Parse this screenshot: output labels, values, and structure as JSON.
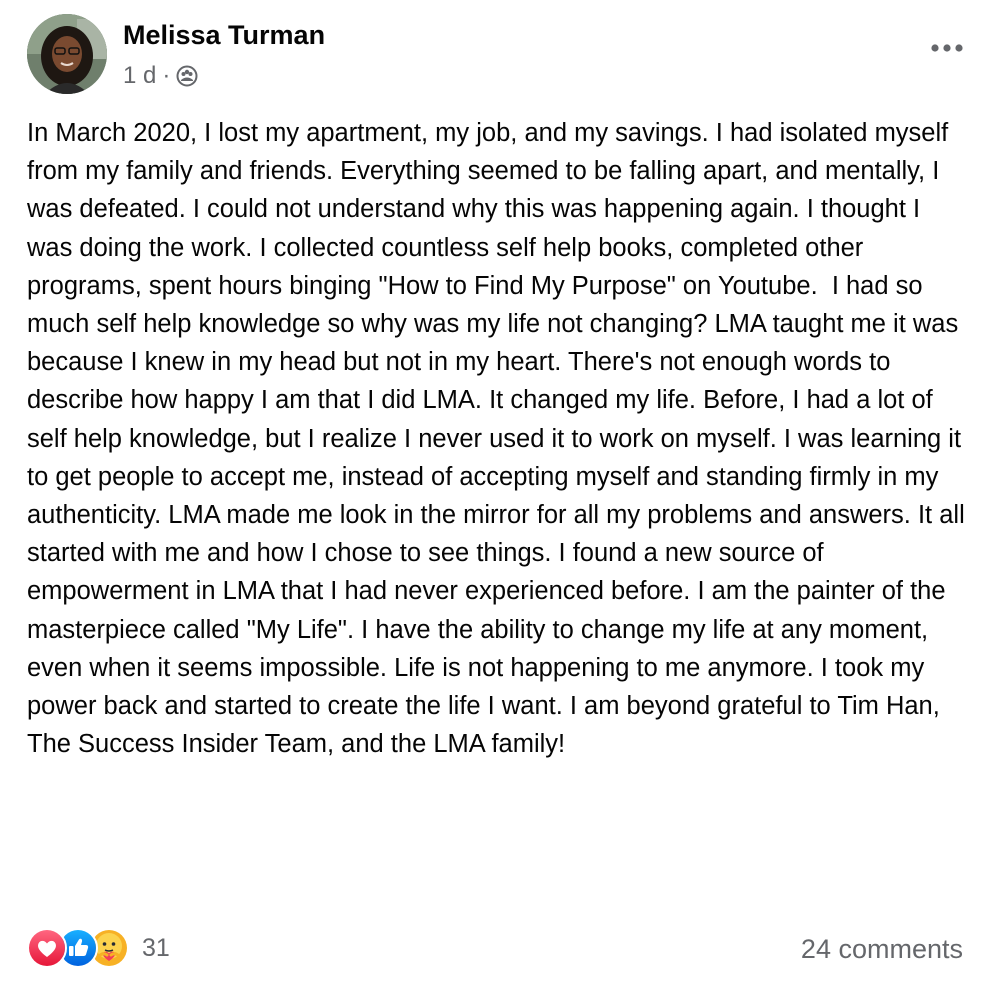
{
  "post": {
    "author": "Melissa Turman",
    "time": "1 d",
    "separator": "·",
    "audience_icon": "friends-group-icon",
    "body": "In March 2020, I lost my apartment, my job, and my savings. I had isolated myself from my family and friends. Everything seemed to be falling apart, and mentally, I was defeated. I could not understand why this was happening again. I thought I was doing the work. I collected countless self help books, completed other programs, spent hours binging \"How to Find My Purpose\" on Youtube.  I had so much self help knowledge so why was my life not changing? LMA taught me it was because I knew in my head but not in my heart. There's not enough words to describe how happy I am that I did LMA. It changed my life. Before, I had a lot of self help knowledge, but I realize I never used it to work on myself. I was learning it to get people to accept me, instead of accepting myself and standing firmly in my authenticity. LMA made me look in the mirror for all my problems and answers. It all started with me and how I chose to see things. I found a new source of empowerment in LMA that I had never experienced before. I am the painter of the masterpiece called \"My Life\". I have the ability to change my life at any moment, even when it seems impossible. Life is not happening to me anymore. I took my power back and started to create the life I want. I am beyond grateful to Tim Han, The Success Insider Team, and the LMA family!"
  },
  "reactions": {
    "icons": [
      "love-reaction-icon",
      "like-reaction-icon",
      "care-reaction-icon"
    ],
    "count": "31"
  },
  "comments": {
    "label": "24 comments"
  },
  "colors": {
    "text_primary": "#050505",
    "text_secondary": "#65676b",
    "love": "#f33e58",
    "like": "#1877f2",
    "care": "#f7b125"
  }
}
